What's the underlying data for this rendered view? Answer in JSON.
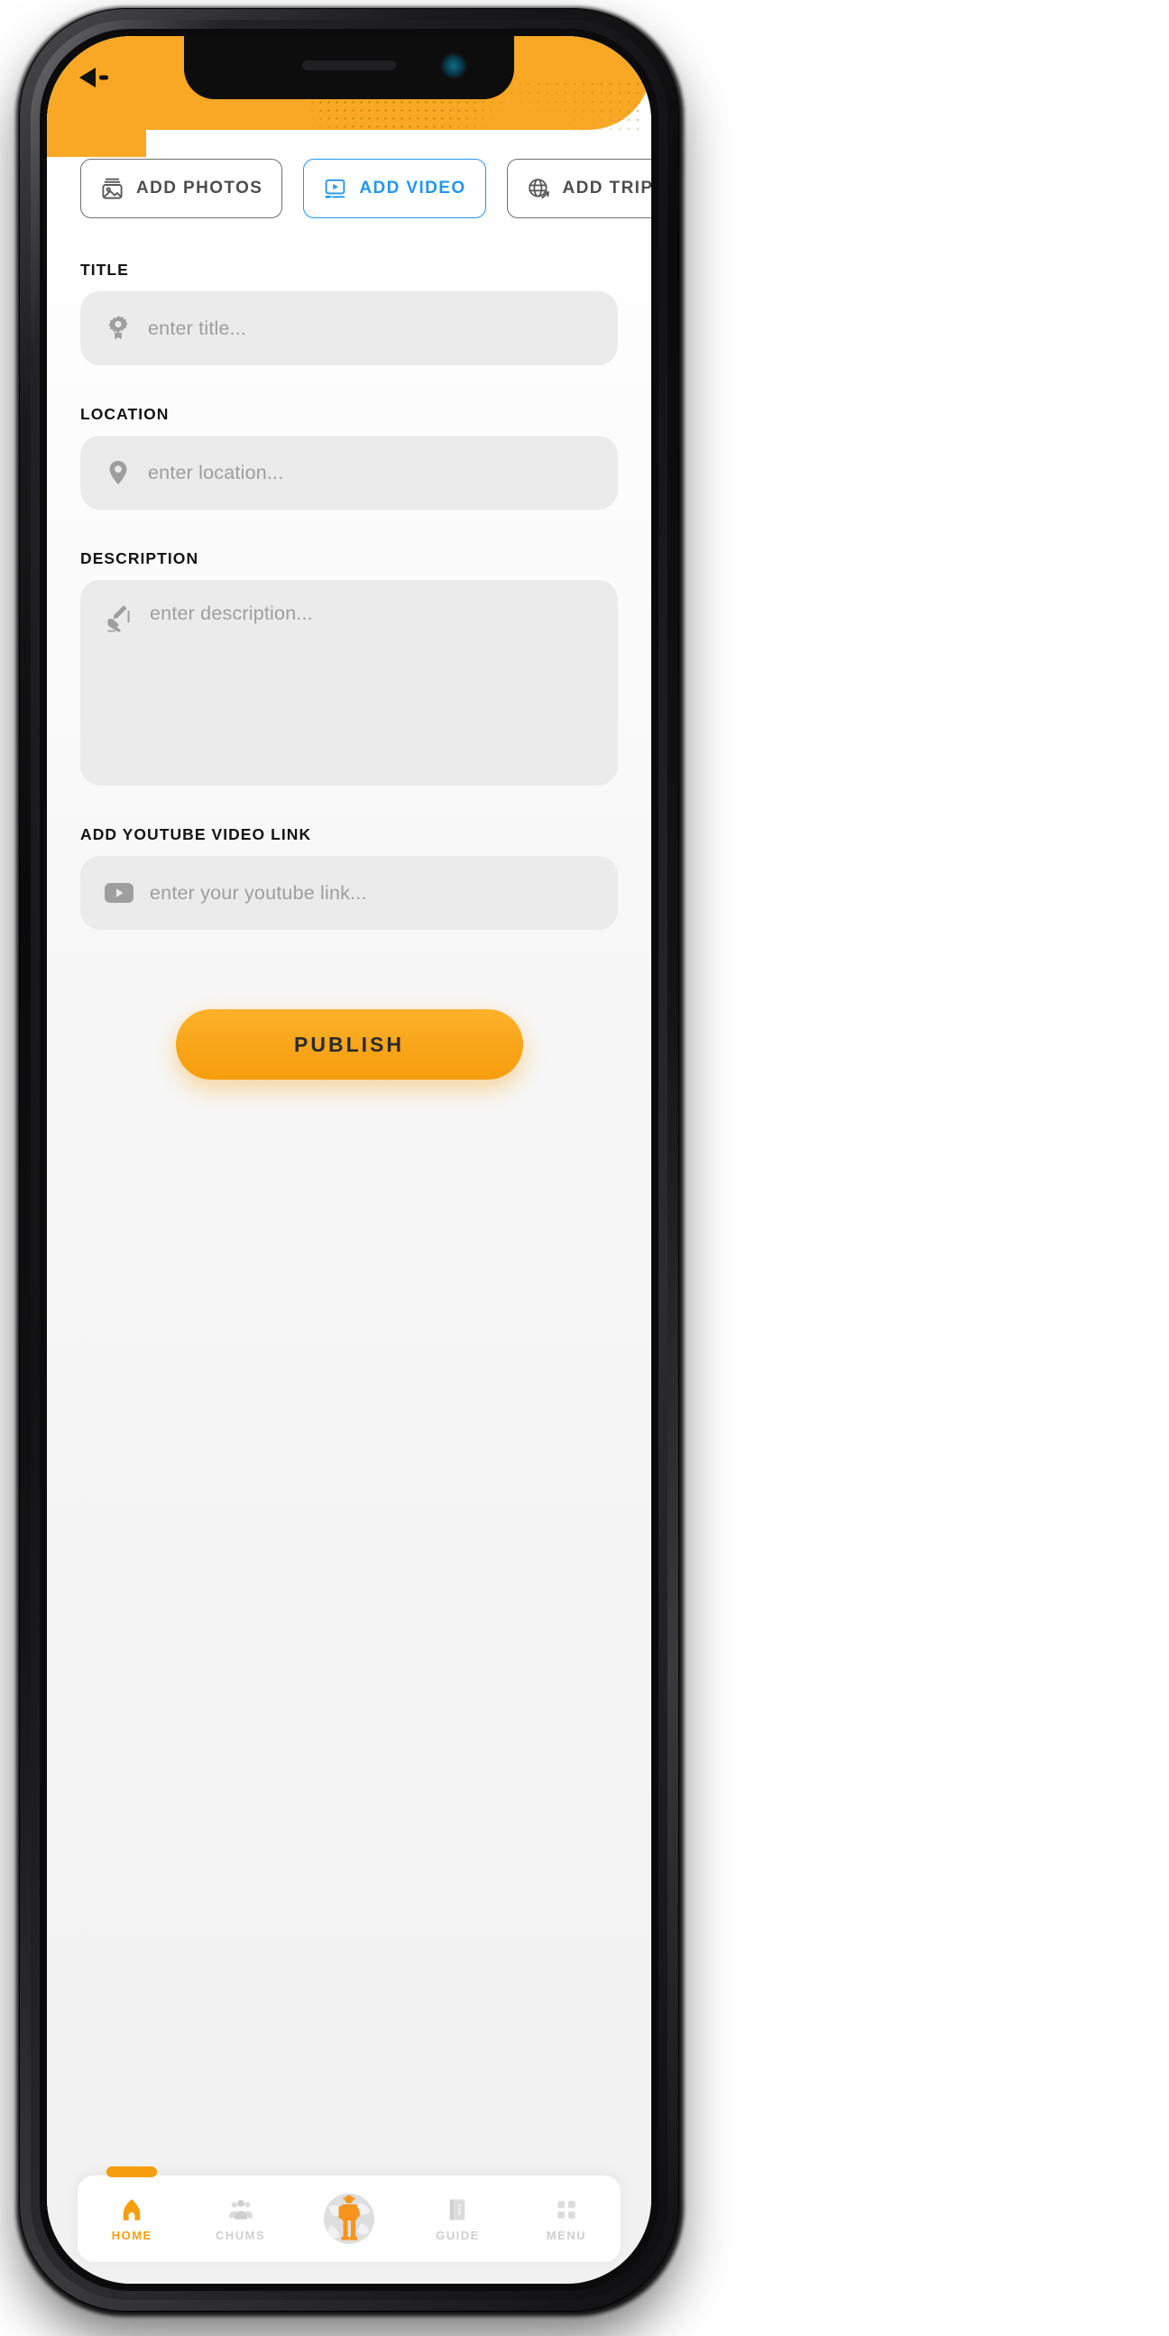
{
  "app": {
    "accent_orange": "#f8a824",
    "accent_blue": "#2196f3",
    "back_icon": "back-arrow-icon"
  },
  "header": {
    "back_label": "Back"
  },
  "tabs": [
    {
      "label": "ADD  PHOTOS",
      "icon": "image-icon",
      "active": false
    },
    {
      "label": "ADD  VIDEO",
      "icon": "video-icon",
      "active": true
    },
    {
      "label": "ADD TRIP",
      "icon": "globe-plane-icon",
      "active": false
    }
  ],
  "fields": {
    "title": {
      "label": "TITLE",
      "placeholder": "enter title...",
      "value": "",
      "icon": "badge-award-icon"
    },
    "location": {
      "label": "LOCATION",
      "placeholder": "enter location...",
      "value": "",
      "icon": "map-pin-icon"
    },
    "description": {
      "label": "DESCRIPTION",
      "placeholder": "enter description...",
      "value": "",
      "icon": "writing-hand-icon"
    },
    "youtube": {
      "label": "ADD YOUTUBE VIDEO LINK",
      "placeholder": "enter your youtube link...",
      "value": "",
      "icon": "youtube-play-icon"
    }
  },
  "actions": {
    "publish_label": "PUBLISH"
  },
  "bottom_nav": {
    "items": [
      {
        "label": "HOME",
        "icon": "home-icon",
        "active": true
      },
      {
        "label": "CHUMS",
        "icon": "people-icon",
        "active": false
      },
      {
        "label": "",
        "icon": "traveler-globe-icon",
        "active": false
      },
      {
        "label": "GUIDE",
        "icon": "guide-book-icon",
        "active": false
      },
      {
        "label": "MENU",
        "icon": "grid-menu-icon",
        "active": false
      }
    ]
  }
}
